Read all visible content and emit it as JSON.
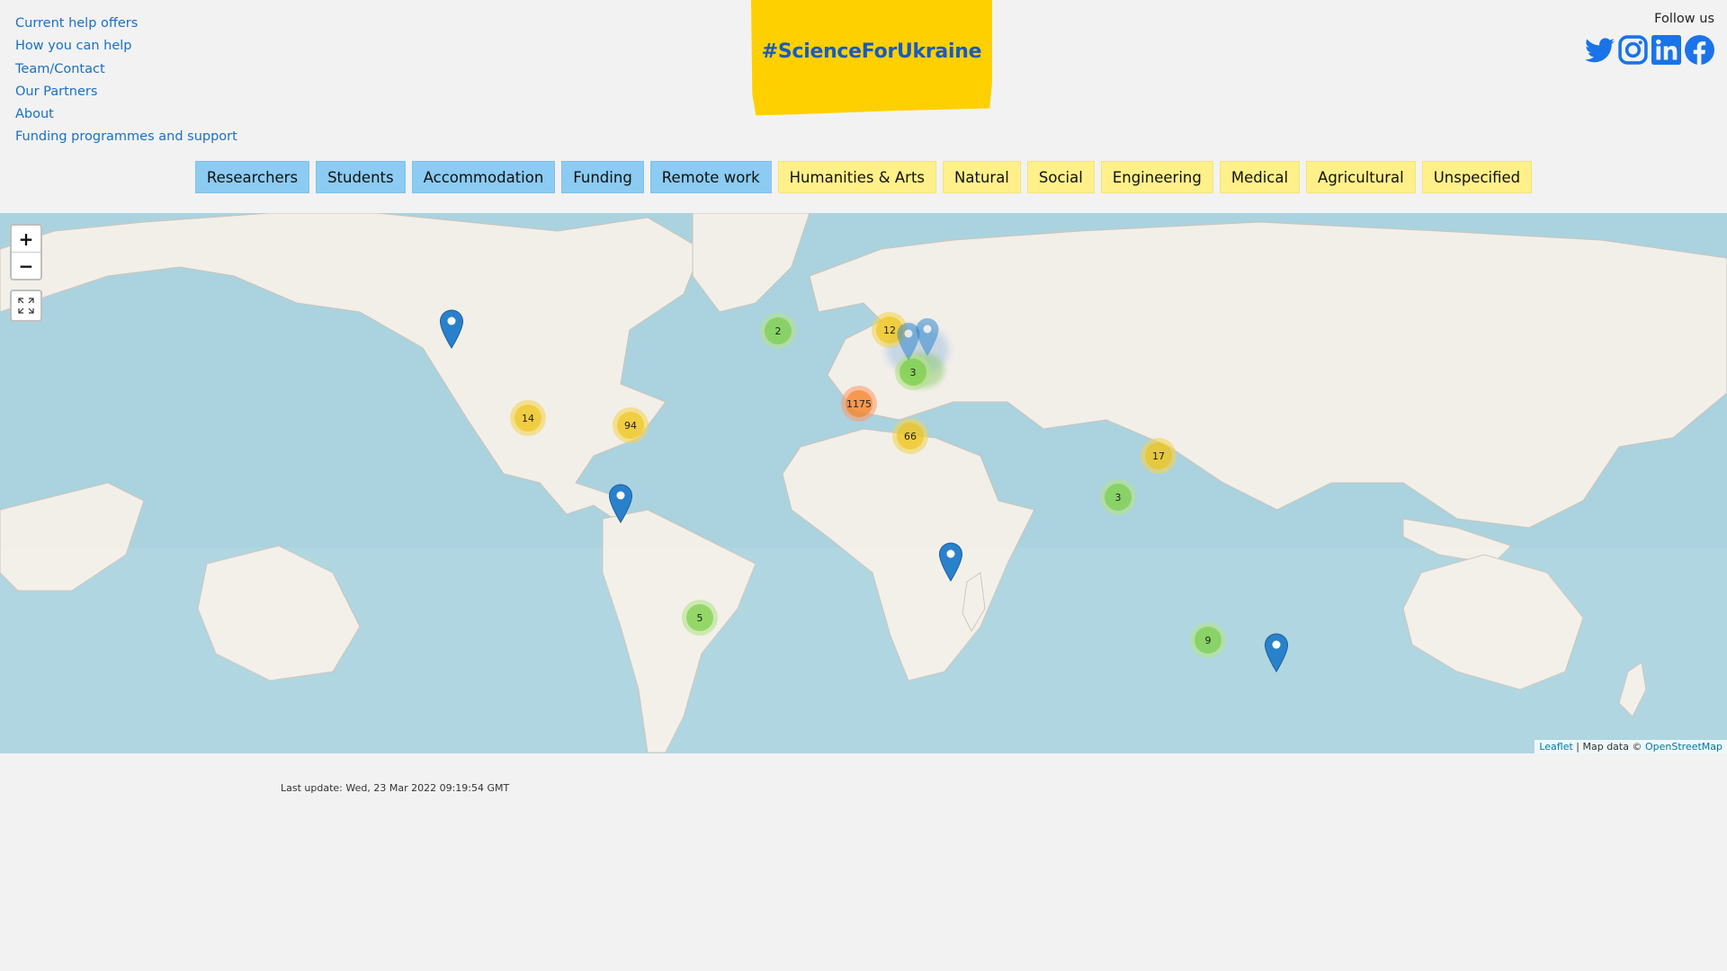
{
  "nav": {
    "links": [
      "Current help offers",
      "How you can help",
      "Team/Contact",
      "Our Partners",
      "About",
      "Funding programmes and support"
    ]
  },
  "logo": {
    "text": "#ScienceForUkraine",
    "color": "#ffd000"
  },
  "follow": {
    "label": "Follow us",
    "icons": [
      "twitter-icon",
      "instagram-icon",
      "linkedin-icon",
      "facebook-icon"
    ]
  },
  "filters": {
    "blue": [
      "Researchers",
      "Students",
      "Accommodation",
      "Funding",
      "Remote work"
    ],
    "yellow": [
      "Humanities & Arts",
      "Natural",
      "Social",
      "Engineering",
      "Medical",
      "Agricultural",
      "Unspecified"
    ]
  },
  "map": {
    "zoom_in": "+",
    "zoom_out": "−",
    "clusters": [
      {
        "label": "2",
        "color": "green"
      },
      {
        "label": "12",
        "color": "yellow"
      },
      {
        "label": "1175",
        "color": "orange"
      },
      {
        "label": "66",
        "color": "yellow"
      },
      {
        "label": "14",
        "color": "yellow"
      },
      {
        "label": "94",
        "color": "yellow"
      },
      {
        "label": "17",
        "color": "yellow"
      },
      {
        "label": "3",
        "color": "green"
      },
      {
        "label": "5",
        "color": "green"
      },
      {
        "label": "9",
        "color": "green"
      },
      {
        "label": "3",
        "color": "green"
      }
    ],
    "attribution": {
      "leaflet": "Leaflet",
      "sep": " | Map data © ",
      "osm": "OpenStreetMap"
    }
  },
  "last_update": "Last update: Wed, 23 Mar 2022 09:19:54 GMT"
}
